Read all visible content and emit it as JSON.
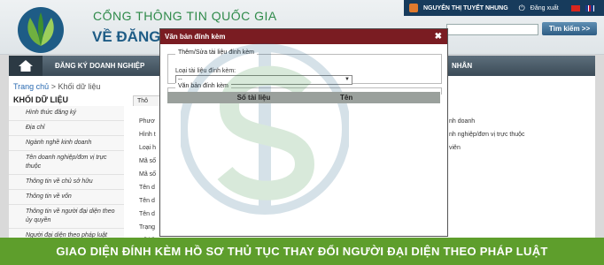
{
  "header": {
    "portal_title": "CỔNG THÔNG TIN QUỐC GIA",
    "portal_sub": "VỀ ĐĂNG",
    "user_name": "NGUYỄN THỊ TUYẾT NHUNG",
    "logout_label": "Đăng xuất",
    "search_button": "Tìm kiếm >>"
  },
  "nav": {
    "item1": "ĐĂNG KÝ DOANH NGHIỆP",
    "item_right": "NHÂN"
  },
  "breadcrumb": {
    "home": "Trang chủ",
    "sep": " > ",
    "current": "Khối dữ liệu"
  },
  "sidebar": {
    "heading": "KHỐI DỮ LIỆU",
    "items": [
      "Hình thức đăng ký",
      "Địa chỉ",
      "Ngành nghề kinh doanh",
      "Tên doanh nghiệp/đơn vị trực thuộc",
      "Thông tin về chủ sở hữu",
      "Thông tin về vốn",
      "Thông tin về người đại diện theo ủy quyền",
      "Người đại diện theo pháp luật"
    ]
  },
  "content": {
    "tab": "Thô",
    "labels": [
      "Phươ",
      "Hình t",
      "Loại h",
      "Mã số",
      "Mã số",
      "Tên d",
      "Tên d",
      "Tên d",
      "Trạng",
      "Số hồ"
    ],
    "right_lines": [
      "nh doanh",
      "nh nghiệp/đơn vị trực thuộc",
      "viên"
    ]
  },
  "modal": {
    "title": "Văn bản đính kèm",
    "fieldset1": "Thêm/Sửa tài liệu đính kèm",
    "select_label": "Loại tài liệu đính kèm:",
    "select_value": "--",
    "fieldset2": "Văn bản đính kèm",
    "col_doc": "Số tài liệu",
    "col_name": "Tên"
  },
  "banner": "GIAO DIỆN ĐÍNH KÈM HỒ SƠ THỦ TỤC THAY ĐỔI NGƯỜI ĐẠI DIỆN THEO PHÁP LUẬT",
  "colors": {
    "banner": "#5e9e2c",
    "modal_header": "#7a1c22",
    "nav": "#3b4b57",
    "accent_blue": "#1e5c86"
  }
}
